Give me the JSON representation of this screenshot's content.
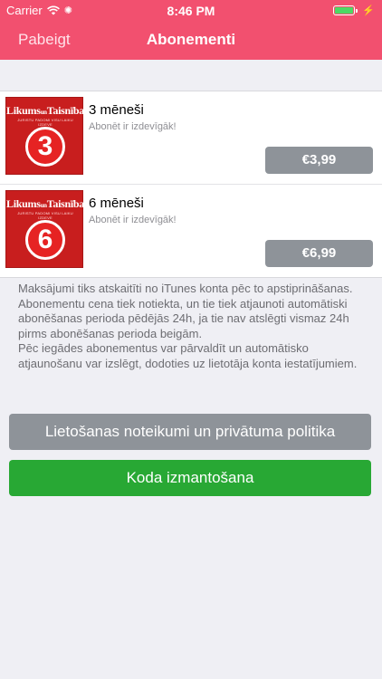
{
  "status_bar": {
    "carrier": "Carrier",
    "time": "8:46 PM"
  },
  "nav": {
    "done_label": "Pabeigt",
    "title": "Abonementi"
  },
  "cover": {
    "logo_text_left": "Likums",
    "logo_text_right": "Taisnība",
    "tagline": "JURISTU PADOMI VISU LAIKU IZDEVE"
  },
  "subscriptions": [
    {
      "badge": "3",
      "title": "3 mēneši",
      "subtitle": "Abonēt ir izdevīgāk!",
      "price": "€3,99"
    },
    {
      "badge": "6",
      "title": "6 mēneši",
      "subtitle": "Abonēt ir izdevīgāk!",
      "price": "€6,99"
    }
  ],
  "disclaimer": "Maksājumi tiks atskaitīti no iTunes konta pēc to apstiprināšanas.\nAbonementu cena tiek notiekta, un tie tiek atjaunoti automātiski abonēšanas perioda pēdējās 24h, ja tie nav atslēgti vismaz 24h pirms abonēšanas perioda beigām.\nPēc iegādes abonementus var pārvaldīt un automātisko atjaunošanu var izslēgt, dodoties uz lietotāja konta iestatījumiem.",
  "buttons": {
    "terms_label": "Lietošanas noteikumi un privātuma politika",
    "code_label": "Koda izmantošana"
  },
  "colors": {
    "nav_background": "#f2506f",
    "price_button": "#8e9399",
    "code_button": "#28a834",
    "battery_fill": "#4cd964"
  }
}
